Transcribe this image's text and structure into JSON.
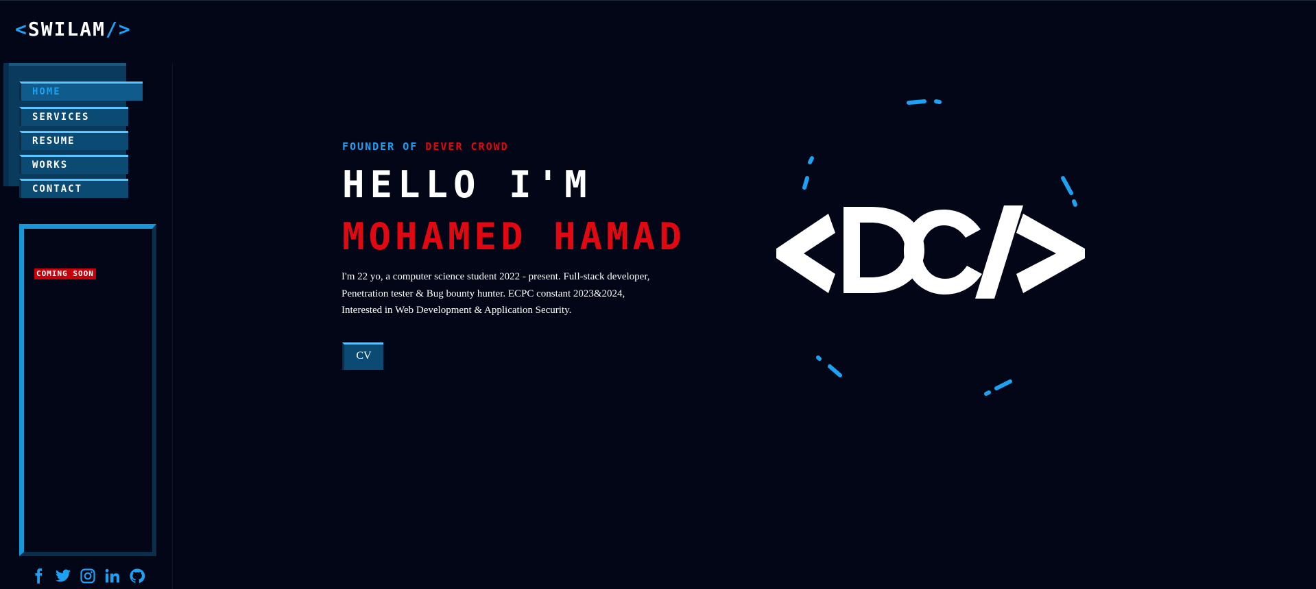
{
  "logo": {
    "open": "<",
    "text": "SWILAM",
    "close": "/>"
  },
  "nav": {
    "items": [
      {
        "label": "HOME",
        "active": true
      },
      {
        "label": "SERVICES",
        "active": false
      },
      {
        "label": "RESUME",
        "active": false
      },
      {
        "label": "WORKS",
        "active": false
      },
      {
        "label": "CONTACT",
        "active": false
      }
    ]
  },
  "sidebar": {
    "badge": "COMING SOON"
  },
  "socials": [
    "facebook-icon",
    "twitter-icon",
    "instagram-icon",
    "linkedin-icon",
    "github-icon"
  ],
  "hero": {
    "founder_prefix": "FOUNDER OF",
    "founder_company": "DEVER CROWD",
    "greeting": "HELLO I'M",
    "name": "MOHAMED HAMAD",
    "bio_lines": [
      "I'm 22 yo, a computer science student 2022 - present. Full-stack developer,",
      "Penetration tester & Bug bounty hunter. ECPC constant 2023&2024,",
      "Interested in Web Development & Application Security."
    ],
    "cv_label": "CV"
  },
  "graphic": {
    "text": "<DC/>",
    "icon": "dever-crowd-logo"
  },
  "colors": {
    "background": "#020617",
    "accent_blue": "#1da1f2",
    "accent_red": "#e10812",
    "button_bg": "#0b4a72"
  }
}
